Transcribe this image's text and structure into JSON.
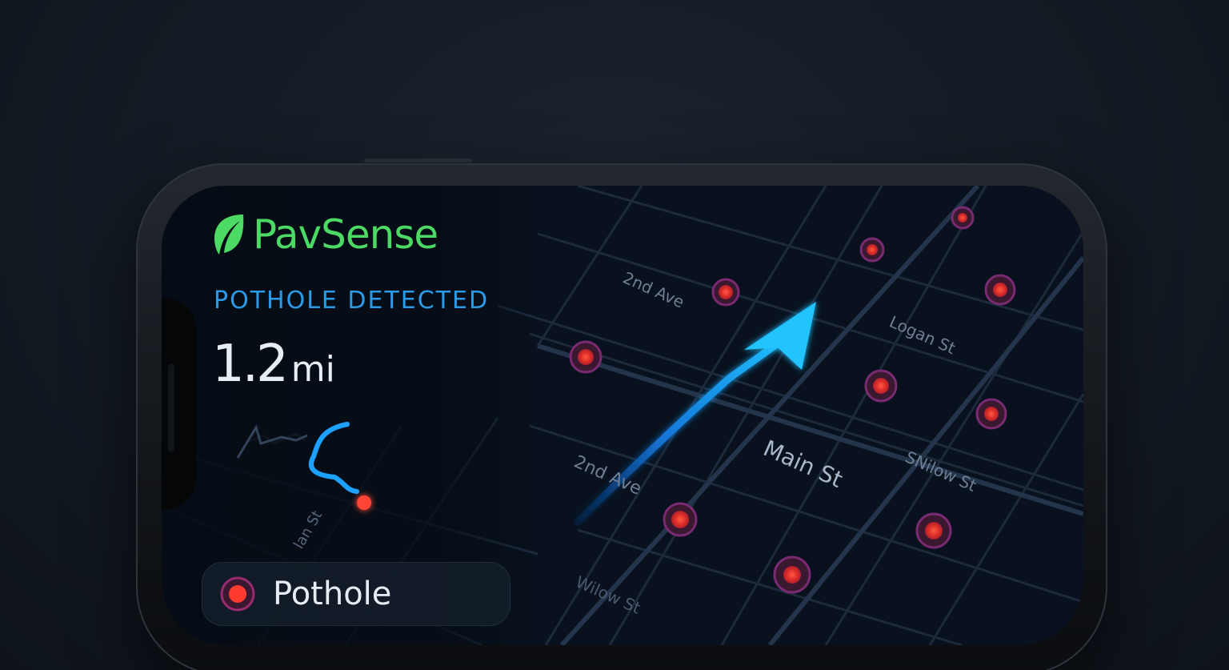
{
  "app": {
    "name": "PavSense",
    "alert_label": "POTHOLE DETECTED",
    "distance_value": "1.2",
    "distance_unit": "mi",
    "legend_label": "Pothole",
    "brand_color": "#4cd964",
    "alert_color": "#2b9be8",
    "marker_color": "#ff4a3a"
  },
  "map": {
    "streets": [
      "2nd Ave",
      "Logan St",
      "Main St",
      "SNilow St",
      "2nd Ave",
      "Wilow St",
      "lan St"
    ],
    "icons": [
      "leaf-icon",
      "direction-arrow-icon",
      "pothole-marker-icon"
    ]
  }
}
